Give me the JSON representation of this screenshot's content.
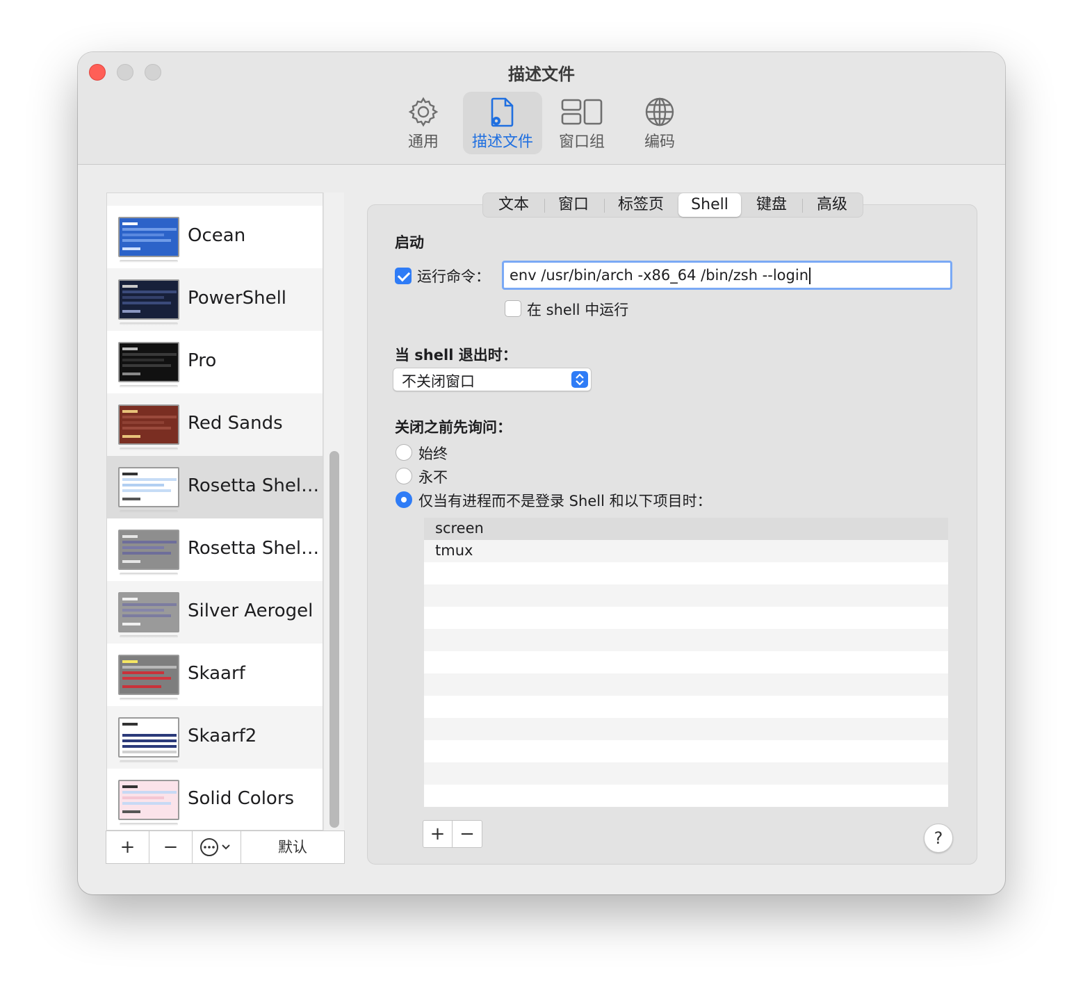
{
  "window": {
    "title": "描述文件"
  },
  "toolbar": {
    "items": [
      {
        "label": "通用",
        "icon": "gear-icon"
      },
      {
        "label": "描述文件",
        "icon": "profile-doc-icon",
        "selected": true
      },
      {
        "label": "窗口组",
        "icon": "window-group-icon"
      },
      {
        "label": "编码",
        "icon": "globe-icon"
      }
    ]
  },
  "profiles": {
    "items": [
      {
        "name": "Ocean"
      },
      {
        "name": "PowerShell"
      },
      {
        "name": "Pro"
      },
      {
        "name": "Red Sands"
      },
      {
        "name": "Rosetta Shel…",
        "selected": true
      },
      {
        "name": "Rosetta Shel…"
      },
      {
        "name": "Silver Aerogel"
      },
      {
        "name": "Skaarf"
      },
      {
        "name": "Skaarf2"
      },
      {
        "name": "Solid Colors"
      }
    ],
    "buttons": {
      "add": "+",
      "remove": "−",
      "default": "默认"
    }
  },
  "tabs": [
    {
      "label": "文本"
    },
    {
      "label": "窗口"
    },
    {
      "label": "标签页"
    },
    {
      "label": "Shell",
      "selected": true
    },
    {
      "label": "键盘"
    },
    {
      "label": "高级"
    }
  ],
  "shell": {
    "startup_title": "启动",
    "run_command_label": "运行命令：",
    "run_command_checked": true,
    "run_command_value": "env /usr/bin/arch -x86_64 /bin/zsh --login",
    "run_in_shell_label": "在 shell 中运行",
    "run_in_shell_checked": false,
    "on_exit_title": "当 shell 退出时：",
    "on_exit_value": "不关闭窗口",
    "ask_before_close_title": "关闭之前先询问：",
    "ask_options": [
      {
        "label": "始终",
        "checked": false
      },
      {
        "label": "永不",
        "checked": false
      },
      {
        "label": "仅当有进程而不是登录 Shell 和以下项目时：",
        "checked": true
      }
    ],
    "processes": [
      "screen",
      "tmux"
    ],
    "add_button": "+",
    "remove_button": "−",
    "help_button": "?"
  },
  "colors": {
    "accent": "#2f7cf6",
    "close": "#ff5f57",
    "selected_toolbar_label": "#1f6fe0"
  }
}
